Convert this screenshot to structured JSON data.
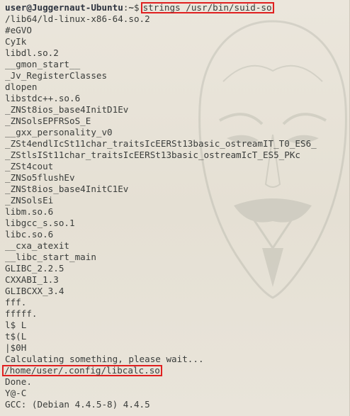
{
  "prompt": {
    "user_host": "user@Juggernaut-Ubuntu",
    "colon": ":",
    "path": "~",
    "dollar": "$",
    "command": "strings /usr/bin/suid-so"
  },
  "output": [
    {
      "text": "/lib64/ld-linux-x86-64.so.2"
    },
    {
      "text": "#eGVO"
    },
    {
      "text": "CyIk"
    },
    {
      "text": "libdl.so.2"
    },
    {
      "text": "__gmon_start__"
    },
    {
      "text": "_Jv_RegisterClasses"
    },
    {
      "text": "dlopen"
    },
    {
      "text": "libstdc++.so.6"
    },
    {
      "text": "_ZNSt8ios_base4InitD1Ev"
    },
    {
      "text": "_ZNSolsEPFRSoS_E"
    },
    {
      "text": "__gxx_personality_v0"
    },
    {
      "text": "_ZSt4endlIcSt11char_traitsIcEERSt13basic_ostreamIT_T0_ES6_"
    },
    {
      "text": "_ZStlsISt11char_traitsIcEERSt13basic_ostreamIcT_ES5_PKc"
    },
    {
      "text": "_ZSt4cout"
    },
    {
      "text": "_ZNSo5flushEv"
    },
    {
      "text": "_ZNSt8ios_base4InitC1Ev"
    },
    {
      "text": "_ZNSolsEi"
    },
    {
      "text": "libm.so.6"
    },
    {
      "text": "libgcc_s.so.1"
    },
    {
      "text": "libc.so.6"
    },
    {
      "text": "__cxa_atexit"
    },
    {
      "text": "__libc_start_main"
    },
    {
      "text": "GLIBC_2.2.5"
    },
    {
      "text": "CXXABI_1.3"
    },
    {
      "text": "GLIBCXX_3.4"
    },
    {
      "text": "fff."
    },
    {
      "text": "fffff."
    },
    {
      "text": "l$ L"
    },
    {
      "text": "t$(L"
    },
    {
      "text": "|$0H"
    },
    {
      "text": "Calculating something, please wait..."
    },
    {
      "text": "/home/user/.config/libcalc.so",
      "highlighted": true
    },
    {
      "text": "Done."
    },
    {
      "text": "Y@-C"
    },
    {
      "text": "GCC: (Debian 4.4.5-8) 4.4.5"
    }
  ],
  "colors": {
    "background": "#e7e2d7",
    "text": "#3a3d3b",
    "highlight_box": "#e02020"
  },
  "icons": {
    "watermark": "guy-fawkes-mask-watermark"
  }
}
